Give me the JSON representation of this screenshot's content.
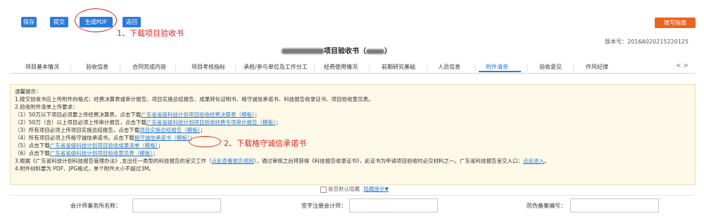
{
  "toolbar": {
    "save": "保存",
    "submit": "提交",
    "generate_pdf": "生成PDF",
    "back": "返回",
    "fill_guide": "填写指南"
  },
  "annotations": {
    "step1": "1、下载项目验收书",
    "step2": "2、下载格守诚信承诺书"
  },
  "header": {
    "title_suffix": "项目验收书（",
    "title_close": "）",
    "version": "版本号：2016A020215220125"
  },
  "tabs": [
    {
      "label": "项目基本情况"
    },
    {
      "label": "验收信息"
    },
    {
      "label": "合同完成内容"
    },
    {
      "label": "项目考核指标"
    },
    {
      "label": "承担/参与单位及工作分工"
    },
    {
      "label": "经费使用情况"
    },
    {
      "label": "前期研究基础"
    },
    {
      "label": "人员信息"
    },
    {
      "label": "附件清单"
    },
    {
      "label": "验收意见"
    },
    {
      "label": "作风纪律"
    }
  ],
  "tab_arrows": "<  >",
  "notice": {
    "heading": "温馨提示：",
    "l1": "1.按交验收书应上传附件的格式：经费决算表或审计报告、项目实施总结报告、成果转化证明书、格守诚信承诺书、科技报告收录证书、项目验收意见表。",
    "l2": "2.验收附件清单上传要求：",
    "l3a": "（1）50万以下项目必须要上传经费决算表，点击下载",
    "l3link": "广东省省级科技计划项目验收经费决算表（模板）",
    "l3b": "；",
    "l4a": "（2）50万（含）以上项目必须上传审计报告，点击下载",
    "l4link": "广东省省级科技计划项目验收经费专项审计报告（模板）",
    "l4b": "；",
    "l5a": "（3）所有项目必须上传项目实施总结报告，点击下载",
    "l5link": "项目实施总结报告（模板）",
    "l5b": "；",
    "l6a": "（4）所有项目必须上传格守诚信承诺书，点击下载",
    "l6link": "格守诚信承诺书（模板）",
    "l6b": "；",
    "l7a": "（5）点击下载",
    "l7link": "广东省省级科技计划项目验收成果清单（模板）",
    "l7b": "；",
    "l8a": "（6）点击下载",
    "l8link": "广东省省级科技计划项目验收意见表（模板）",
    "l8b": "；",
    "l9a": "3.根据《广东省科技计划科技报告管理办法》,支出任一类型的科技报告的呈交工作（",
    "l9link1": "点此查看报告规则",
    "l9b": "），通过审核之后将获得《科技报告收录证书》，此证书为申请项目验收时必交材料之一。广东省科技报告呈交入口：",
    "l9link2": "点此进入",
    "l9c": "。",
    "l10": "4.附件材料要为 PDF、JPG格式，单个附件大小不超过3M。"
  },
  "options": {
    "default_hide": "是否默认隐藏",
    "hide_tip": "隐藏提示▼"
  },
  "form": {
    "firm_label": "会计师事务所名称：",
    "firm_value": "",
    "cpa_label": "签字注册会计师：",
    "cpa_value": "",
    "code_label": "防伪备案编号：",
    "code_value": ""
  }
}
